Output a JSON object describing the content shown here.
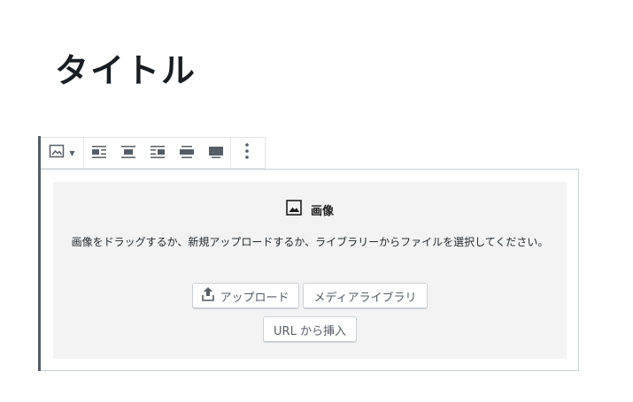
{
  "post": {
    "title": "タイトル"
  },
  "toolbar": {
    "block_type_icon": "image-icon",
    "alignment_icons": [
      "align-left-icon",
      "align-center-icon",
      "align-right-icon",
      "align-wide-icon",
      "align-full-icon"
    ],
    "more_icon": "more-vertical-icon"
  },
  "image_block": {
    "label": "画像",
    "label_icon": "image-icon",
    "instructions": "画像をドラッグするか、新規アップロードするか、ライブラリーからファイルを選択してください。",
    "upload_button": "アップロード",
    "upload_icon": "upload-icon",
    "media_library_button": "メディアライブラリ",
    "insert_url_button": "URL から挿入"
  },
  "colors": {
    "text": "#1e1e1e",
    "border": "#ccd0d4",
    "placeholder_bg": "#f3f3f3",
    "block_accent": "#555d66"
  }
}
